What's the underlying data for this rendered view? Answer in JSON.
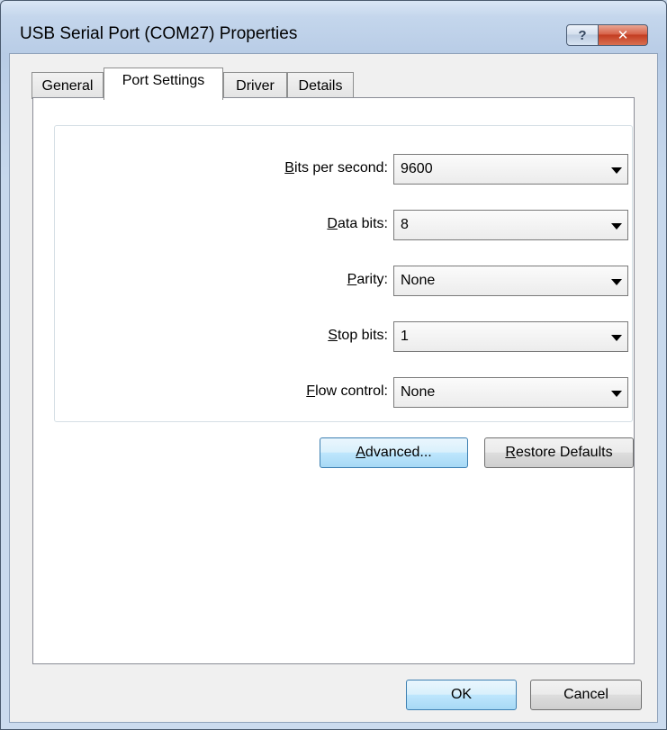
{
  "window": {
    "title": "USB Serial Port (COM27) Properties",
    "help_glyph": "?",
    "close_glyph": "✕"
  },
  "tabs": [
    {
      "label": "General",
      "active": false
    },
    {
      "label": "Port Settings",
      "active": true
    },
    {
      "label": "Driver",
      "active": false
    },
    {
      "label": "Details",
      "active": false
    }
  ],
  "settings": {
    "bits_per_second": {
      "mnemonic": "B",
      "rest": "its per second:",
      "value": "9600"
    },
    "data_bits": {
      "mnemonic": "D",
      "rest": "ata bits:",
      "value": "8"
    },
    "parity": {
      "mnemonic": "P",
      "rest": "arity:",
      "value": "None"
    },
    "stop_bits": {
      "mnemonic": "S",
      "rest": "top bits:",
      "value": "1"
    },
    "flow_control": {
      "mnemonic": "F",
      "rest": "low control:",
      "value": "None"
    }
  },
  "buttons": {
    "advanced": {
      "mnemonic": "A",
      "rest": "dvanced..."
    },
    "restore": {
      "mnemonic": "R",
      "rest": "estore Defaults"
    },
    "ok": "OK",
    "cancel": "Cancel"
  },
  "colors": {
    "titlebar": "#c4d6ec",
    "close_button": "#c33d22",
    "focus_button": "#bee6fd"
  }
}
